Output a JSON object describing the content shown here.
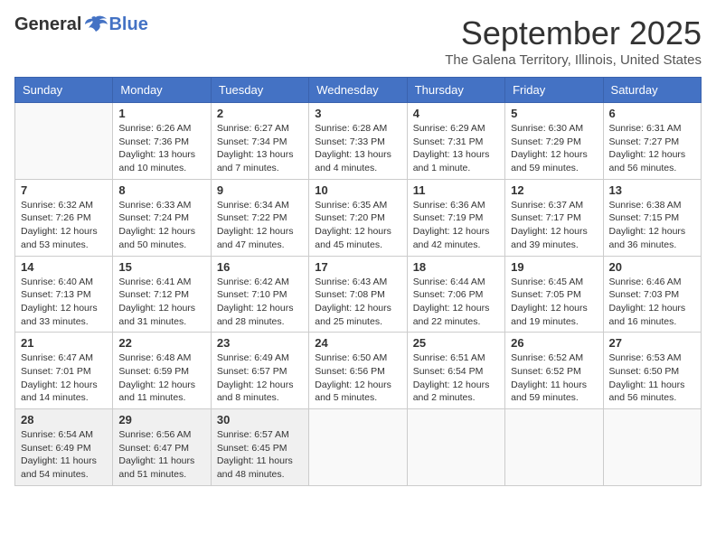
{
  "logo": {
    "general": "General",
    "blue": "Blue"
  },
  "title": "September 2025",
  "subtitle": "The Galena Territory, Illinois, United States",
  "headers": [
    "Sunday",
    "Monday",
    "Tuesday",
    "Wednesday",
    "Thursday",
    "Friday",
    "Saturday"
  ],
  "weeks": [
    [
      {
        "day": "",
        "info": ""
      },
      {
        "day": "1",
        "info": "Sunrise: 6:26 AM\nSunset: 7:36 PM\nDaylight: 13 hours\nand 10 minutes."
      },
      {
        "day": "2",
        "info": "Sunrise: 6:27 AM\nSunset: 7:34 PM\nDaylight: 13 hours\nand 7 minutes."
      },
      {
        "day": "3",
        "info": "Sunrise: 6:28 AM\nSunset: 7:33 PM\nDaylight: 13 hours\nand 4 minutes."
      },
      {
        "day": "4",
        "info": "Sunrise: 6:29 AM\nSunset: 7:31 PM\nDaylight: 13 hours\nand 1 minute."
      },
      {
        "day": "5",
        "info": "Sunrise: 6:30 AM\nSunset: 7:29 PM\nDaylight: 12 hours\nand 59 minutes."
      },
      {
        "day": "6",
        "info": "Sunrise: 6:31 AM\nSunset: 7:27 PM\nDaylight: 12 hours\nand 56 minutes."
      }
    ],
    [
      {
        "day": "7",
        "info": "Sunrise: 6:32 AM\nSunset: 7:26 PM\nDaylight: 12 hours\nand 53 minutes."
      },
      {
        "day": "8",
        "info": "Sunrise: 6:33 AM\nSunset: 7:24 PM\nDaylight: 12 hours\nand 50 minutes."
      },
      {
        "day": "9",
        "info": "Sunrise: 6:34 AM\nSunset: 7:22 PM\nDaylight: 12 hours\nand 47 minutes."
      },
      {
        "day": "10",
        "info": "Sunrise: 6:35 AM\nSunset: 7:20 PM\nDaylight: 12 hours\nand 45 minutes."
      },
      {
        "day": "11",
        "info": "Sunrise: 6:36 AM\nSunset: 7:19 PM\nDaylight: 12 hours\nand 42 minutes."
      },
      {
        "day": "12",
        "info": "Sunrise: 6:37 AM\nSunset: 7:17 PM\nDaylight: 12 hours\nand 39 minutes."
      },
      {
        "day": "13",
        "info": "Sunrise: 6:38 AM\nSunset: 7:15 PM\nDaylight: 12 hours\nand 36 minutes."
      }
    ],
    [
      {
        "day": "14",
        "info": "Sunrise: 6:40 AM\nSunset: 7:13 PM\nDaylight: 12 hours\nand 33 minutes."
      },
      {
        "day": "15",
        "info": "Sunrise: 6:41 AM\nSunset: 7:12 PM\nDaylight: 12 hours\nand 31 minutes."
      },
      {
        "day": "16",
        "info": "Sunrise: 6:42 AM\nSunset: 7:10 PM\nDaylight: 12 hours\nand 28 minutes."
      },
      {
        "day": "17",
        "info": "Sunrise: 6:43 AM\nSunset: 7:08 PM\nDaylight: 12 hours\nand 25 minutes."
      },
      {
        "day": "18",
        "info": "Sunrise: 6:44 AM\nSunset: 7:06 PM\nDaylight: 12 hours\nand 22 minutes."
      },
      {
        "day": "19",
        "info": "Sunrise: 6:45 AM\nSunset: 7:05 PM\nDaylight: 12 hours\nand 19 minutes."
      },
      {
        "day": "20",
        "info": "Sunrise: 6:46 AM\nSunset: 7:03 PM\nDaylight: 12 hours\nand 16 minutes."
      }
    ],
    [
      {
        "day": "21",
        "info": "Sunrise: 6:47 AM\nSunset: 7:01 PM\nDaylight: 12 hours\nand 14 minutes."
      },
      {
        "day": "22",
        "info": "Sunrise: 6:48 AM\nSunset: 6:59 PM\nDaylight: 12 hours\nand 11 minutes."
      },
      {
        "day": "23",
        "info": "Sunrise: 6:49 AM\nSunset: 6:57 PM\nDaylight: 12 hours\nand 8 minutes."
      },
      {
        "day": "24",
        "info": "Sunrise: 6:50 AM\nSunset: 6:56 PM\nDaylight: 12 hours\nand 5 minutes."
      },
      {
        "day": "25",
        "info": "Sunrise: 6:51 AM\nSunset: 6:54 PM\nDaylight: 12 hours\nand 2 minutes."
      },
      {
        "day": "26",
        "info": "Sunrise: 6:52 AM\nSunset: 6:52 PM\nDaylight: 11 hours\nand 59 minutes."
      },
      {
        "day": "27",
        "info": "Sunrise: 6:53 AM\nSunset: 6:50 PM\nDaylight: 11 hours\nand 56 minutes."
      }
    ],
    [
      {
        "day": "28",
        "info": "Sunrise: 6:54 AM\nSunset: 6:49 PM\nDaylight: 11 hours\nand 54 minutes."
      },
      {
        "day": "29",
        "info": "Sunrise: 6:56 AM\nSunset: 6:47 PM\nDaylight: 11 hours\nand 51 minutes."
      },
      {
        "day": "30",
        "info": "Sunrise: 6:57 AM\nSunset: 6:45 PM\nDaylight: 11 hours\nand 48 minutes."
      },
      {
        "day": "",
        "info": ""
      },
      {
        "day": "",
        "info": ""
      },
      {
        "day": "",
        "info": ""
      },
      {
        "day": "",
        "info": ""
      }
    ]
  ]
}
